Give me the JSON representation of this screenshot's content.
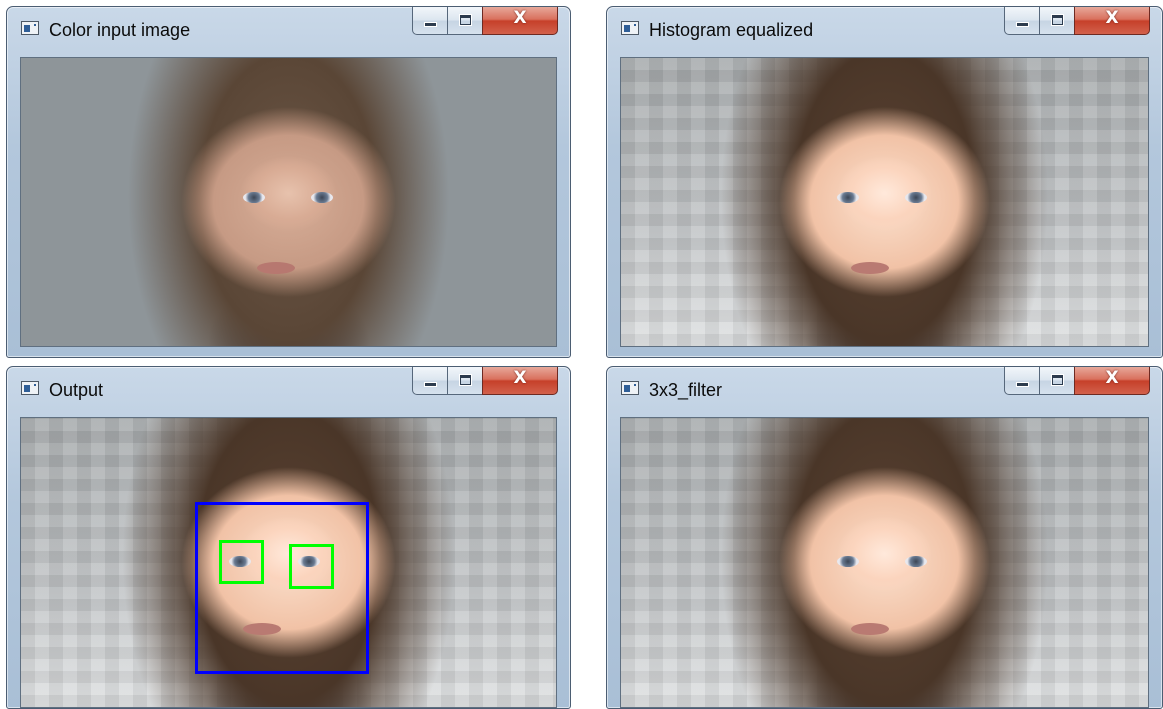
{
  "windows": [
    {
      "id": "color-input",
      "title": "Color input image",
      "image": "original"
    },
    {
      "id": "hist-eq",
      "title": "Histogram equalized",
      "image": "equalized"
    },
    {
      "id": "output",
      "title": "Output",
      "image": "equalized",
      "detections": true
    },
    {
      "id": "filter",
      "title": "3x3_filter",
      "image": "equalized"
    }
  ],
  "detection_colors": {
    "face": "#0000ff",
    "eyes": "#00ff00"
  },
  "icons": {
    "app": "window-app-icon",
    "minimize": "minimize-icon",
    "maximize": "maximize-icon",
    "close": "close-icon"
  },
  "close_glyph": "X"
}
